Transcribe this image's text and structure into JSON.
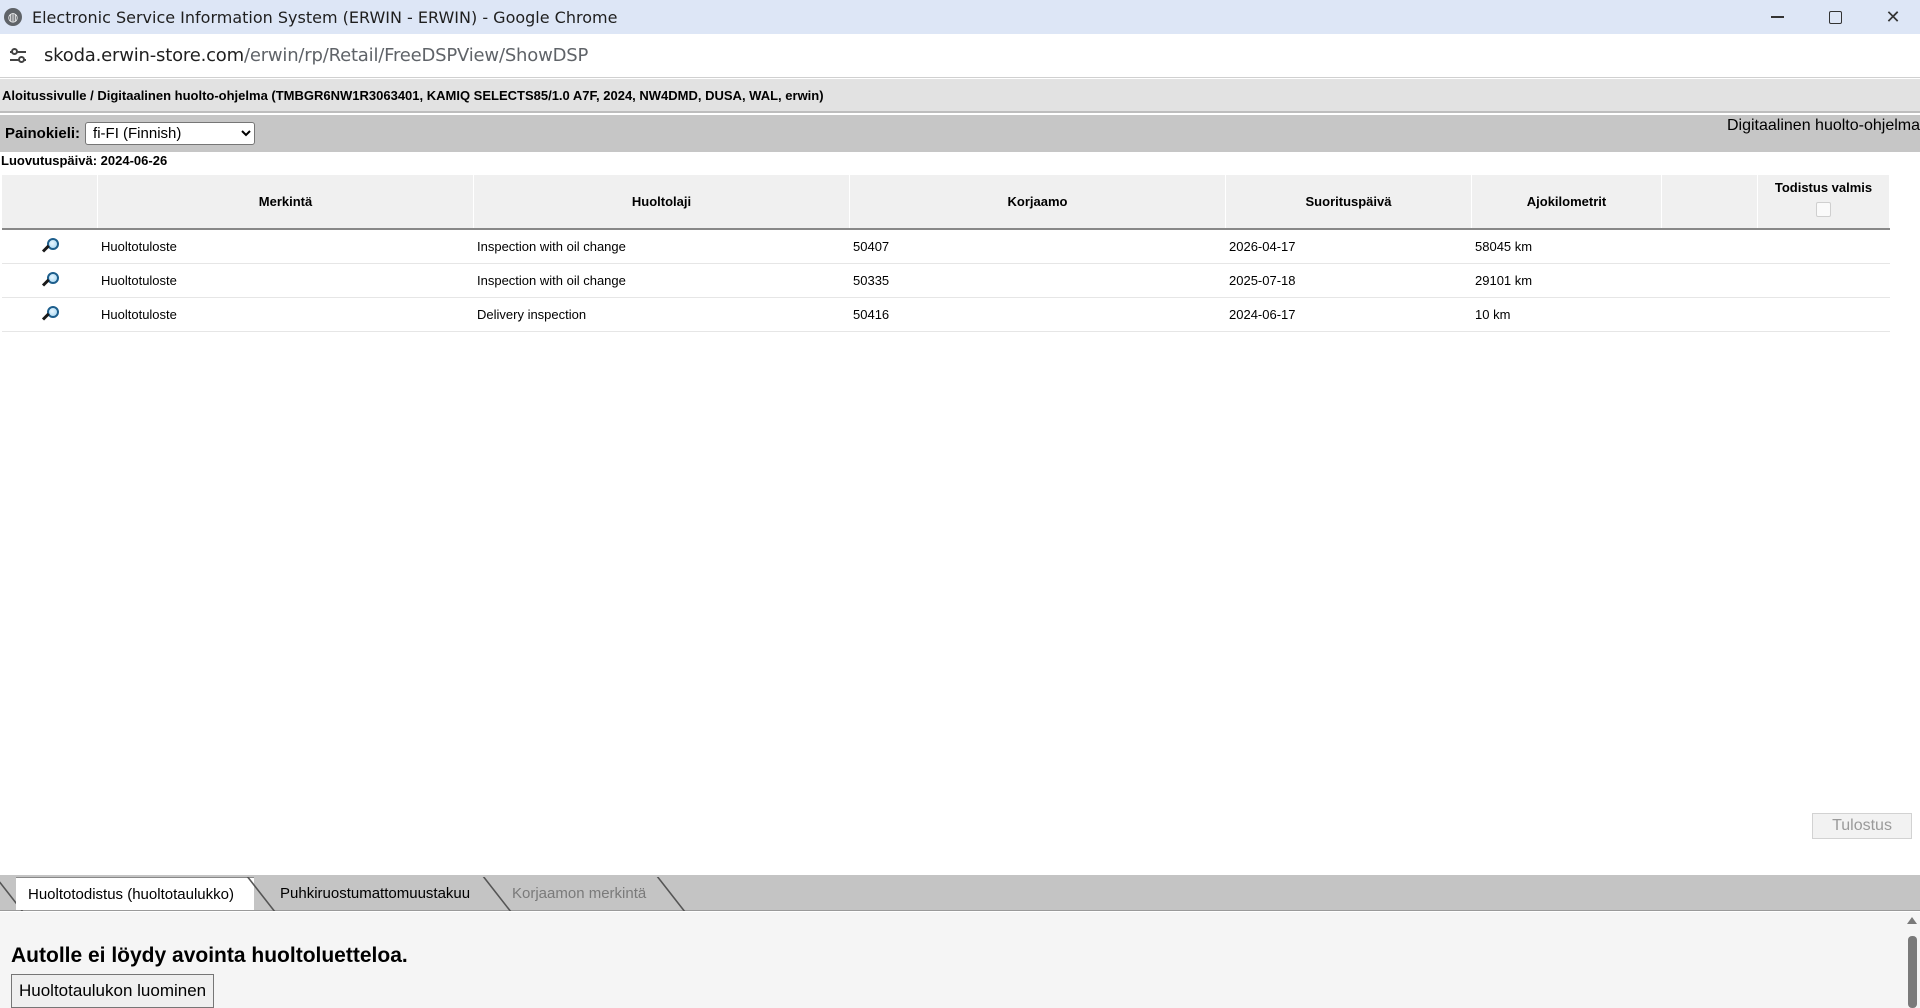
{
  "window": {
    "title": "Electronic Service Information System (ERWIN - ERWIN) - Google Chrome",
    "url_host": "skoda.erwin-store.com",
    "url_path": "/erwin/rp/Retail/FreeDSPView/ShowDSP"
  },
  "breadcrumb": "Aloitussivulle / Digitaalinen huolto-ohjelma (TMBGR6NW1R3063401, KAMIQ SELECTS85/1.0 A7F, 2024, NW4DMD, DUSA, WAL, erwin)",
  "language": {
    "label": "Painokieli:",
    "selected": "fi-FI (Finnish)",
    "right_title": "Digitaalinen huolto-ohjelma"
  },
  "delivery_date": "Luovutuspäivä: 2024-06-26",
  "table": {
    "headers": [
      "",
      "Merkintä",
      "Huoltolaji",
      "Korjaamo",
      "Suorituspäivä",
      "Ajokilometrit",
      "",
      "Todistus valmis"
    ],
    "rows": [
      {
        "merkinta": "Huoltotuloste",
        "huoltolaji": "Inspection with oil change",
        "korjaamo": "50407",
        "paiva": "2026-04-17",
        "km": "58045 km"
      },
      {
        "merkinta": "Huoltotuloste",
        "huoltolaji": "Inspection with oil change",
        "korjaamo": "50335",
        "paiva": "2025-07-18",
        "km": "29101 km"
      },
      {
        "merkinta": "Huoltotuloste",
        "huoltolaji": "Delivery inspection",
        "korjaamo": "50416",
        "paiva": "2024-06-17",
        "km": "10 km"
      }
    ]
  },
  "print_button": "Tulostus",
  "tabs": [
    {
      "label": "Huoltotodistus (huoltotaulukko)",
      "state": "active"
    },
    {
      "label": "Puhkiruostumattomuustakuu",
      "state": "normal"
    },
    {
      "label": "Korjaamon merkintä",
      "state": "disabled"
    }
  ],
  "bottom": {
    "message": "Autolle ei löydy avointa huoltoluetteloa.",
    "create_button": "Huoltotaulukon luominen"
  },
  "icons": {
    "browser": "globe-icon",
    "site_settings": "tune-icon",
    "row_view": "magnifier-icon"
  }
}
